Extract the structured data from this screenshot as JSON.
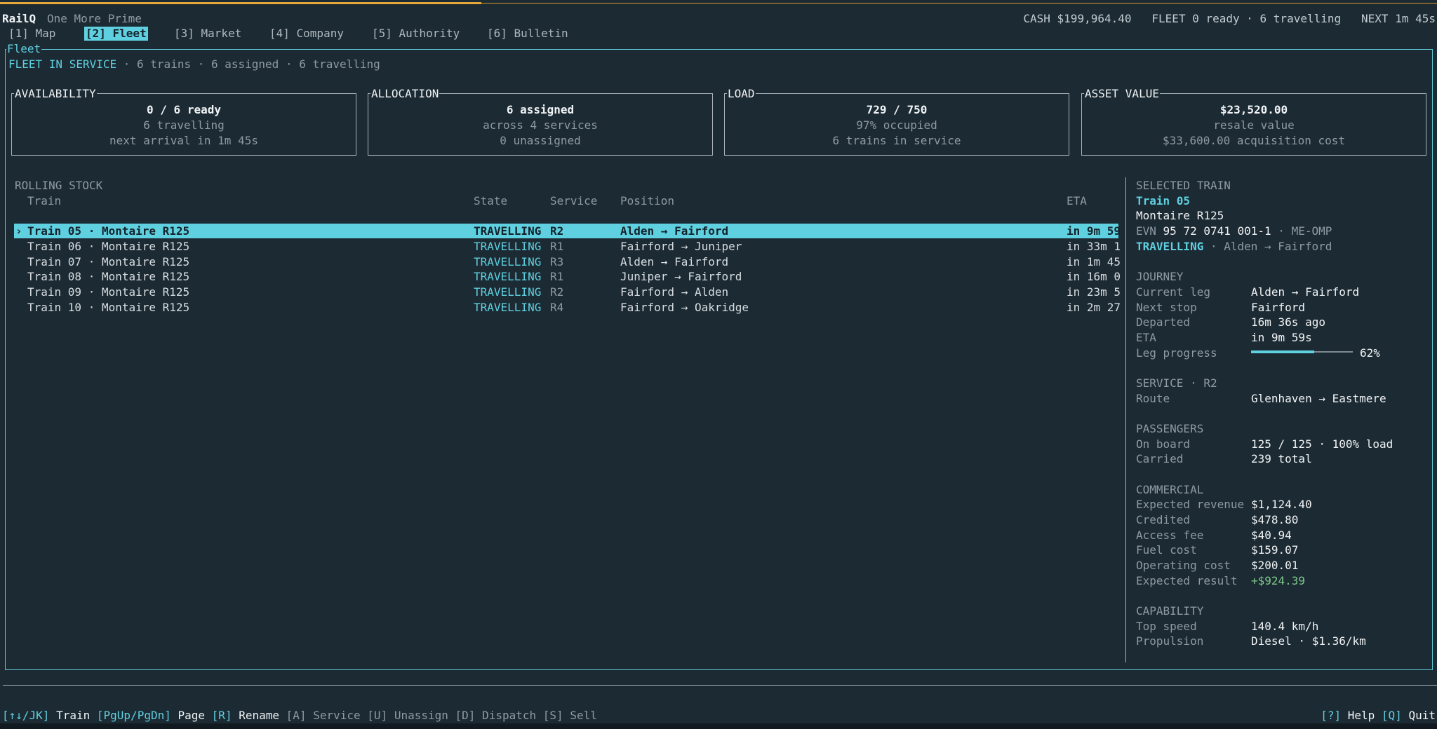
{
  "app": {
    "name": "RailQ",
    "company": "One More Prime"
  },
  "status": {
    "cash": "CASH $199,964.40",
    "fleet": "FLEET 0 ready · 6 travelling",
    "next": "NEXT 1m 45s"
  },
  "tabs": [
    "[1] Map",
    "[2] Fleet",
    "[3] Market",
    "[4] Company",
    "[5] Authority",
    "[6] Bulletin"
  ],
  "active_tab": "[2] Fleet",
  "fleet": {
    "frame_title": "Fleet",
    "header_label": "FLEET IN SERVICE",
    "header_detail": " · 6 trains · 6 assigned · 6 travelling"
  },
  "cards": {
    "availability": {
      "title": "AVAILABILITY",
      "line1": "0 / 6 ready",
      "line2": "6 travelling",
      "line3": "next arrival in 1m 45s"
    },
    "allocation": {
      "title": "ALLOCATION",
      "line1": "6 assigned",
      "line2": "across 4 services",
      "line3": "0 unassigned"
    },
    "load": {
      "title": "LOAD",
      "line1": "729 / 750",
      "line2": "97% occupied",
      "line3": "6 trains in service"
    },
    "asset": {
      "title": "ASSET VALUE",
      "line1": "$23,520.00",
      "line2": "resale value",
      "line3": "$33,600.00 acquisition cost"
    }
  },
  "rolling_stock": {
    "title": "ROLLING STOCK",
    "columns": {
      "train": "Train",
      "state": "State",
      "service": "Service",
      "position": "Position",
      "eta": "ETA"
    },
    "selected_marker": "›",
    "rows": [
      {
        "train": "Train 05 · Montaire R125",
        "state": "TRAVELLING",
        "service": "R2",
        "position": "Alden → Fairford",
        "eta": "in 9m 59"
      },
      {
        "train": "Train 06 · Montaire R125",
        "state": "TRAVELLING",
        "service": "R1",
        "position": "Fairford → Juniper",
        "eta": "in 33m 1"
      },
      {
        "train": "Train 07 · Montaire R125",
        "state": "TRAVELLING",
        "service": "R3",
        "position": "Alden → Fairford",
        "eta": "in 1m 45"
      },
      {
        "train": "Train 08 · Montaire R125",
        "state": "TRAVELLING",
        "service": "R1",
        "position": "Juniper → Fairford",
        "eta": "in 16m 0"
      },
      {
        "train": "Train 09 · Montaire R125",
        "state": "TRAVELLING",
        "service": "R2",
        "position": "Fairford → Alden",
        "eta": "in 23m 5"
      },
      {
        "train": "Train 10 · Montaire R125",
        "state": "TRAVELLING",
        "service": "R4",
        "position": "Fairford → Oakridge",
        "eta": "in 2m 27"
      }
    ]
  },
  "selected": {
    "title": "SELECTED TRAIN",
    "name": "Train 05",
    "model": "Montaire R125",
    "evn_label": "EVN",
    "evn_value": "95 72 0741 001-1",
    "evn_suffix": " · ME-OMP",
    "state": "TRAVELLING",
    "state_detail": " · Alden → Fairford",
    "journey": {
      "title": "JOURNEY",
      "current_leg_label": "Current leg",
      "current_leg": "Alden → Fairford",
      "next_stop_label": "Next stop",
      "next_stop": "Fairford",
      "departed_label": "Departed",
      "departed": "16m 36s ago",
      "eta_label": "ETA",
      "eta": "in 9m 59s",
      "leg_progress_label": "Leg progress",
      "leg_progress_text": "62%",
      "leg_progress": 0.62
    },
    "service": {
      "title": "SERVICE · R2",
      "route_label": "Route",
      "route": "Glenhaven → Eastmere"
    },
    "passengers": {
      "title": "PASSENGERS",
      "on_board_label": "On board",
      "on_board": "125 / 125 · 100% load",
      "carried_label": "Carried",
      "carried": "239 total"
    },
    "commercial": {
      "title": "COMMERCIAL",
      "expected_revenue_label": "Expected revenue",
      "expected_revenue": "$1,124.40",
      "credited_label": "Credited",
      "credited": "$478.80",
      "access_fee_label": "Access fee",
      "access_fee": "$40.94",
      "fuel_cost_label": "Fuel cost",
      "fuel_cost": "$159.07",
      "operating_cost_label": "Operating cost",
      "operating_cost": "$200.01",
      "expected_result_label": "Expected result",
      "expected_result": "+$924.39"
    },
    "capability": {
      "title": "CAPABILITY",
      "top_speed_label": "Top speed",
      "top_speed": "140.4 km/h",
      "propulsion_label": "Propulsion",
      "propulsion": "Diesel · $1.36/km"
    }
  },
  "footer": {
    "k1": "[↑↓/JK]",
    "a1": "Train",
    "k2": "[PgUp/PgDn]",
    "a2": "Page",
    "k3": "[R]",
    "a3": "Rename",
    "k4": "[A]",
    "a4": "Service",
    "k5": "[U]",
    "a5": "Unassign",
    "k6": "[D]",
    "a6": "Dispatch",
    "k7": "[S]",
    "a7": "Sell",
    "k8": "[?]",
    "a8": "Help",
    "k9": "[Q]",
    "a9": "Quit"
  },
  "colors": {
    "accent": "#5fd0e0",
    "background": "#1c2a33",
    "positive": "#7ec98a",
    "top_bar": "#e5a63a"
  }
}
